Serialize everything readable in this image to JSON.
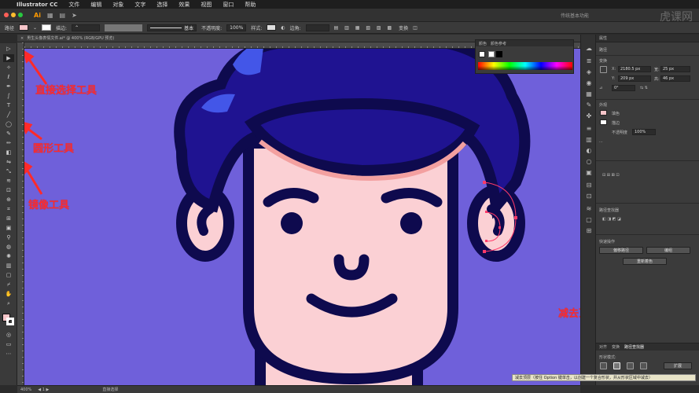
{
  "menubar": {
    "apple": "",
    "items": [
      "Illustrator CC",
      "文件",
      "编辑",
      "对象",
      "文字",
      "选择",
      "效果",
      "视图",
      "窗口",
      "帮助"
    ]
  },
  "appbar": {
    "workspace": "传统基本功能",
    "watermark": "虎课网"
  },
  "controlbar": {
    "path_label": "路径",
    "stroke_label": "描边:",
    "stroke_style": "基本",
    "opacity_label": "不透明度:",
    "opacity_value": "100%",
    "style_label": "样式:",
    "corner_label": "边角:",
    "transform_label": "变换",
    "colors": {
      "fill": "#f6c5c9"
    }
  },
  "document": {
    "tab_title": "男生头像表情文件.ai* @ 400% (RGB/GPU 预览)",
    "zoom": "400%",
    "status_text": "直接选择"
  },
  "annotations": {
    "direct_select": "直接选择工具",
    "ellipse": "圆形工具",
    "reflect": "镜像工具",
    "minus_front": "减去顶层"
  },
  "color_panel": {
    "tabs": [
      "颜色",
      "颜色参考"
    ]
  },
  "properties": {
    "title": "属性",
    "section_path": "路径",
    "section_transform": "变换",
    "x_label": "X:",
    "x_value": "2180.5 px",
    "y_label": "Y:",
    "y_value": "209 px",
    "w_label": "宽:",
    "w_value": "25 px",
    "h_label": "高:",
    "h_value": "46 px",
    "angle_value": "0°",
    "section_appearance": "外观",
    "fill_label": "填色",
    "stroke_label": "描边",
    "opacity_label": "不透明度",
    "opacity_value": "100%",
    "section_align": "路径查找器",
    "section_quick": "快速操作",
    "btn_offset": "偏移路径",
    "btn_recolor": "编组",
    "btn_arrange": "重新着色"
  },
  "pathfinder": {
    "tabs": [
      "对齐",
      "变换",
      "路径查找器"
    ],
    "shape_modes": "形状模式:",
    "expand": "扩展"
  },
  "tooltip": {
    "text": "减去顶层（按住 Option 键单击，以创建一个复合形状，并从形状区域中减去）"
  },
  "colors": {
    "canvas_bg": "#6f60da",
    "hair": "#1f1391",
    "hair_highlight": "#4356e8",
    "skin": "#fbd0d4",
    "outline": "#0e0a4e",
    "annotation": "#ff2a2a"
  }
}
